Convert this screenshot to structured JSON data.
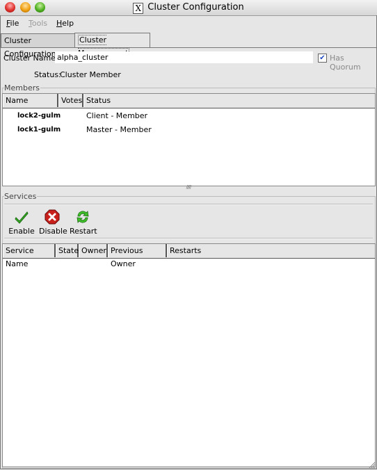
{
  "window": {
    "title": "Cluster Configuration",
    "x_icon": "X"
  },
  "menu": {
    "items": [
      {
        "label": "File",
        "mnemonic": "F",
        "rest": "ile",
        "enabled": true
      },
      {
        "label": "Tools",
        "mnemonic": "T",
        "rest": "ools",
        "enabled": false
      },
      {
        "label": "Help",
        "mnemonic": "H",
        "rest": "elp",
        "enabled": true
      }
    ]
  },
  "tabs": [
    {
      "label": "Cluster Configuration",
      "active": false
    },
    {
      "label": "Cluster Management",
      "active": true
    }
  ],
  "cluster": {
    "name_label": "Cluster Name:",
    "name_value": "alpha_cluster",
    "quorum_label": "Has Quorum",
    "quorum_checked": true,
    "status_label": "Status:",
    "status_value": "Cluster Member"
  },
  "members": {
    "group_label": "Members",
    "columns": [
      "Name",
      "Votes",
      "Status"
    ],
    "rows": [
      {
        "name": "lock2-gulm",
        "votes": "",
        "status": "Client - Member"
      },
      {
        "name": "lock1-gulm",
        "votes": "",
        "status": "Master - Member"
      }
    ]
  },
  "splitter": {
    "grip": "/////"
  },
  "services": {
    "group_label": "Services",
    "toolbar": [
      {
        "label": "Enable",
        "icon": "check-icon"
      },
      {
        "label": "Disable",
        "icon": "stop-icon"
      },
      {
        "label": "Restart",
        "icon": "restart-icon"
      }
    ],
    "columns": [
      "Service Name",
      "State",
      "Owner",
      "Previous Owner",
      "Restarts"
    ],
    "rows": []
  }
}
